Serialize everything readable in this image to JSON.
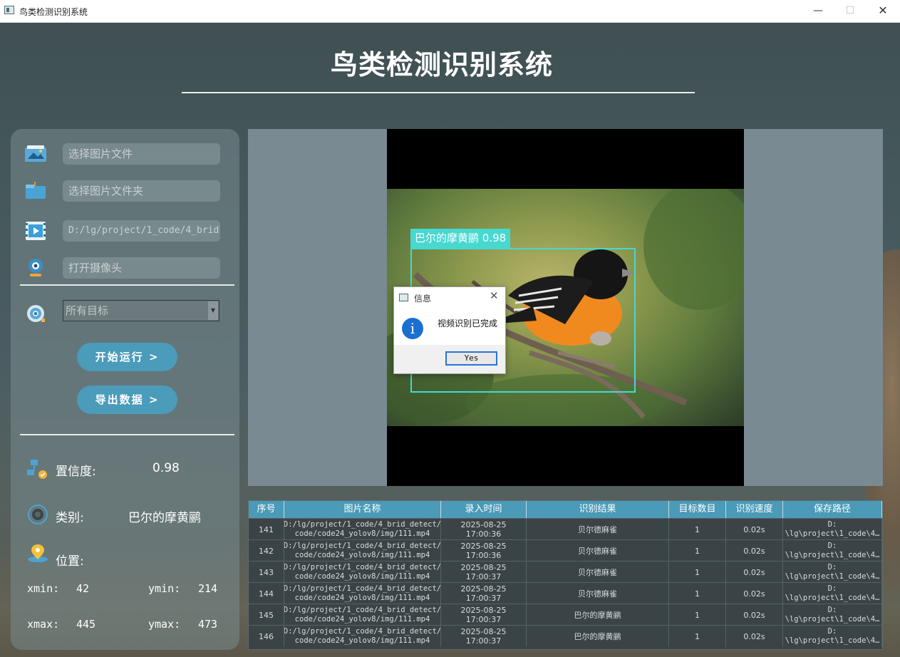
{
  "window": {
    "title": "鸟类检测识别系统",
    "controls": {
      "minimize": "—",
      "maximize": "☐",
      "close": "✕"
    }
  },
  "header": {
    "title": "鸟类检测识别系统"
  },
  "sidebar": {
    "image_file_placeholder": "选择图片文件",
    "image_folder_placeholder": "选择图片文件夹",
    "video_path_value": "D:/lg/project/1_code/4_brid",
    "camera_placeholder": "打开摄像头",
    "target_select": {
      "selected": "所有目标",
      "arrow": "▼"
    },
    "start_button": "开始运行 >",
    "export_button": "导出数据 >",
    "confidence_label": "置信度:",
    "confidence_value": "0.98",
    "class_label": "类别:",
    "class_value": "巴尔的摩黄鹂",
    "position_label": "位置:",
    "xmin_label": "xmin:",
    "xmin_value": "42",
    "ymin_label": "ymin:",
    "ymin_value": "214",
    "xmax_label": "xmax:",
    "xmax_value": "445",
    "ymax_label": "ymax:",
    "ymax_value": "473"
  },
  "viewer": {
    "detection_label": "巴尔的摩黄鹂 0.98",
    "box_color": "#47d8d0"
  },
  "dialog": {
    "title": "信息",
    "close": "✕",
    "icon": "i",
    "message": "视频识别已完成",
    "yes_button": "Yes"
  },
  "table": {
    "headers": [
      "序号",
      "图片名称",
      "录入时间",
      "识别结果",
      "目标数目",
      "识别速度",
      "保存路径"
    ],
    "rows": [
      {
        "id": "141",
        "name_1": "D:/lg/project/1_code/4_brid_detect/",
        "name_2": "code/code24_yolov8/img/111.mp4",
        "date": "2025-08-25",
        "time": "17:00:36",
        "result": "贝尔德麻雀",
        "count": "1",
        "speed": "0.02s",
        "path_1": "D:",
        "path_2": "\\lg\\project\\1_code\\4…"
      },
      {
        "id": "142",
        "name_1": "D:/lg/project/1_code/4_brid_detect/",
        "name_2": "code/code24_yolov8/img/111.mp4",
        "date": "2025-08-25",
        "time": "17:00:36",
        "result": "贝尔德麻雀",
        "count": "1",
        "speed": "0.02s",
        "path_1": "D:",
        "path_2": "\\lg\\project\\1_code\\4…"
      },
      {
        "id": "143",
        "name_1": "D:/lg/project/1_code/4_brid_detect/",
        "name_2": "code/code24_yolov8/img/111.mp4",
        "date": "2025-08-25",
        "time": "17:00:37",
        "result": "贝尔德麻雀",
        "count": "1",
        "speed": "0.02s",
        "path_1": "D:",
        "path_2": "\\lg\\project\\1_code\\4…"
      },
      {
        "id": "144",
        "name_1": "D:/lg/project/1_code/4_brid_detect/",
        "name_2": "code/code24_yolov8/img/111.mp4",
        "date": "2025-08-25",
        "time": "17:00:37",
        "result": "贝尔德麻雀",
        "count": "1",
        "speed": "0.02s",
        "path_1": "D:",
        "path_2": "\\lg\\project\\1_code\\4…"
      },
      {
        "id": "145",
        "name_1": "D:/lg/project/1_code/4_brid_detect/",
        "name_2": "code/code24_yolov8/img/111.mp4",
        "date": "2025-08-25",
        "time": "17:00:37",
        "result": "巴尔的摩黄鹂",
        "count": "1",
        "speed": "0.02s",
        "path_1": "D:",
        "path_2": "\\lg\\project\\1_code\\4…"
      },
      {
        "id": "146",
        "name_1": "D:/lg/project/1_code/4_brid_detect/",
        "name_2": "code/code24_yolov8/img/111.mp4",
        "date": "2025-08-25",
        "time": "17:00:37",
        "result": "巴尔的摩黄鹂",
        "count": "1",
        "speed": "0.02s",
        "path_1": "D:",
        "path_2": "\\lg\\project\\1_code\\4…"
      }
    ]
  }
}
